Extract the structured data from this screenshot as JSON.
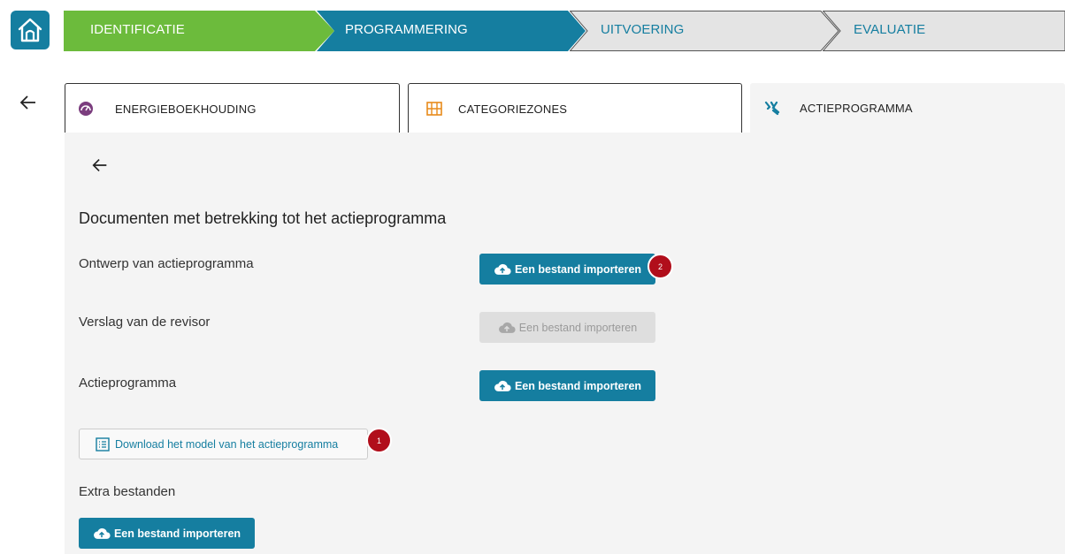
{
  "steps": [
    {
      "label": "IDENTIFICATIE",
      "state": "done",
      "color": "#6cbb3c"
    },
    {
      "label": "PROGRAMMERING",
      "state": "active",
      "color": "#157ea0"
    },
    {
      "label": "UITVOERING",
      "state": "todo",
      "color": "#e4e4e4"
    },
    {
      "label": "EVALUATIE",
      "state": "todo",
      "color": "#e4e4e4"
    }
  ],
  "tabs": [
    {
      "label": "ENERGIEBOEKHOUDING",
      "icon": "gauge-icon",
      "icon_color": "#7b3d7e"
    },
    {
      "label": "CATEGORIEZONES",
      "icon": "map-icon",
      "icon_color": "#e88a1a"
    },
    {
      "label": "ACTIEPROGRAMMA",
      "icon": "tools-icon",
      "icon_color": "#157ea0"
    }
  ],
  "panel": {
    "title": "Documenten met betrekking tot het actieprogramma",
    "rows": [
      {
        "label": "Ontwerp van actieprogramma",
        "button": "Een bestand importeren",
        "enabled": true,
        "badge": "2"
      },
      {
        "label": "Verslag van de revisor",
        "button": "Een bestand importeren",
        "enabled": false
      },
      {
        "label": "Actieprogramma",
        "button": "Een bestand importeren",
        "enabled": true
      }
    ],
    "download_label": "Download het model van het actieprogramma",
    "download_badge": "1",
    "extra_label": "Extra bestanden",
    "extra_button": "Een bestand importeren"
  },
  "colors": {
    "primary": "#157ea0",
    "success": "#6cbb3c",
    "badge": "#b10e1b",
    "panel_bg": "#f4f4f4"
  }
}
